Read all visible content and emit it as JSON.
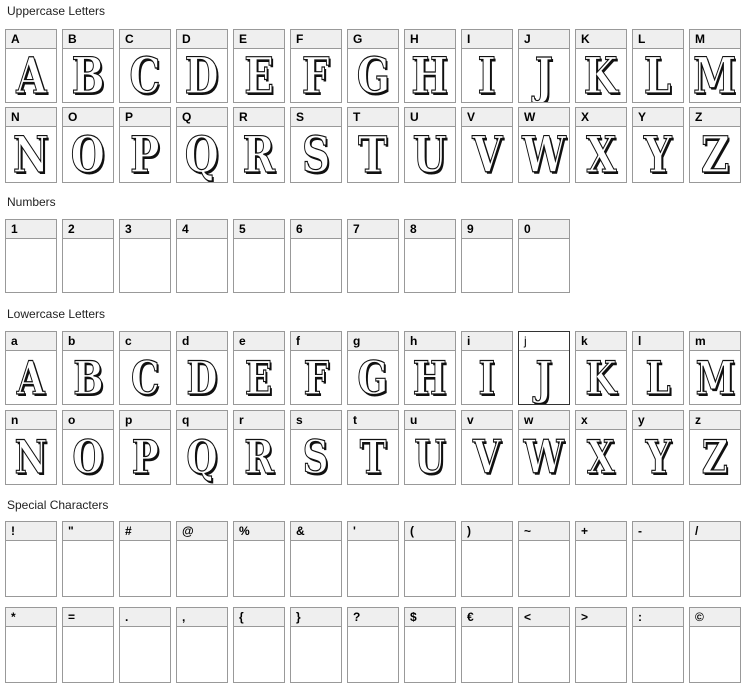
{
  "sections": {
    "uppercase": {
      "title": "Uppercase Letters",
      "cells": [
        {
          "label": "A",
          "glyph": "A"
        },
        {
          "label": "B",
          "glyph": "B"
        },
        {
          "label": "C",
          "glyph": "C"
        },
        {
          "label": "D",
          "glyph": "D"
        },
        {
          "label": "E",
          "glyph": "E"
        },
        {
          "label": "F",
          "glyph": "F"
        },
        {
          "label": "G",
          "glyph": "G"
        },
        {
          "label": "H",
          "glyph": "H"
        },
        {
          "label": "I",
          "glyph": "I"
        },
        {
          "label": "J",
          "glyph": "J"
        },
        {
          "label": "K",
          "glyph": "K"
        },
        {
          "label": "L",
          "glyph": "L"
        },
        {
          "label": "M",
          "glyph": "M"
        },
        {
          "label": "N",
          "glyph": "N"
        },
        {
          "label": "O",
          "glyph": "O"
        },
        {
          "label": "P",
          "glyph": "P"
        },
        {
          "label": "Q",
          "glyph": "Q"
        },
        {
          "label": "R",
          "glyph": "R"
        },
        {
          "label": "S",
          "glyph": "S"
        },
        {
          "label": "T",
          "glyph": "T"
        },
        {
          "label": "U",
          "glyph": "U"
        },
        {
          "label": "V",
          "glyph": "V"
        },
        {
          "label": "W",
          "glyph": "W"
        },
        {
          "label": "X",
          "glyph": "X"
        },
        {
          "label": "Y",
          "glyph": "Y"
        },
        {
          "label": "Z",
          "glyph": "Z"
        }
      ]
    },
    "numbers": {
      "title": "Numbers",
      "cells": [
        {
          "label": "1",
          "glyph": ""
        },
        {
          "label": "2",
          "glyph": ""
        },
        {
          "label": "3",
          "glyph": ""
        },
        {
          "label": "4",
          "glyph": ""
        },
        {
          "label": "5",
          "glyph": ""
        },
        {
          "label": "6",
          "glyph": ""
        },
        {
          "label": "7",
          "glyph": ""
        },
        {
          "label": "8",
          "glyph": ""
        },
        {
          "label": "9",
          "glyph": ""
        },
        {
          "label": "0",
          "glyph": ""
        }
      ]
    },
    "lowercase": {
      "title": "Lowercase Letters",
      "cells": [
        {
          "label": "a",
          "glyph": "A"
        },
        {
          "label": "b",
          "glyph": "B"
        },
        {
          "label": "c",
          "glyph": "C"
        },
        {
          "label": "d",
          "glyph": "D"
        },
        {
          "label": "e",
          "glyph": "E"
        },
        {
          "label": "f",
          "glyph": "F"
        },
        {
          "label": "g",
          "glyph": "G"
        },
        {
          "label": "h",
          "glyph": "H"
        },
        {
          "label": "i",
          "glyph": "I"
        },
        {
          "label": "j",
          "glyph": "J"
        },
        {
          "label": "k",
          "glyph": "K"
        },
        {
          "label": "l",
          "glyph": "L"
        },
        {
          "label": "m",
          "glyph": "M"
        },
        {
          "label": "n",
          "glyph": "N"
        },
        {
          "label": "o",
          "glyph": "O"
        },
        {
          "label": "p",
          "glyph": "P"
        },
        {
          "label": "q",
          "glyph": "Q"
        },
        {
          "label": "r",
          "glyph": "R"
        },
        {
          "label": "s",
          "glyph": "S"
        },
        {
          "label": "t",
          "glyph": "T"
        },
        {
          "label": "u",
          "glyph": "U"
        },
        {
          "label": "v",
          "glyph": "V"
        },
        {
          "label": "w",
          "glyph": "W"
        },
        {
          "label": "x",
          "glyph": "X"
        },
        {
          "label": "y",
          "glyph": "Y"
        },
        {
          "label": "z",
          "glyph": "Z"
        }
      ]
    },
    "special": {
      "title": "Special Characters",
      "cells": [
        {
          "label": "!",
          "glyph": ""
        },
        {
          "label": "\"",
          "glyph": ""
        },
        {
          "label": "#",
          "glyph": ""
        },
        {
          "label": "@",
          "glyph": ""
        },
        {
          "label": "%",
          "glyph": ""
        },
        {
          "label": "&",
          "glyph": ""
        },
        {
          "label": "'",
          "glyph": ""
        },
        {
          "label": "(",
          "glyph": ""
        },
        {
          "label": ")",
          "glyph": ""
        },
        {
          "label": "~",
          "glyph": ""
        },
        {
          "label": "+",
          "glyph": ""
        },
        {
          "label": "-",
          "glyph": ""
        },
        {
          "label": "/",
          "glyph": ""
        },
        {
          "label": "*",
          "glyph": ""
        },
        {
          "label": "=",
          "glyph": ""
        },
        {
          "label": ".",
          "glyph": ""
        },
        {
          "label": ",",
          "glyph": ""
        },
        {
          "label": "{",
          "glyph": ""
        },
        {
          "label": "}",
          "glyph": ""
        },
        {
          "label": "?",
          "glyph": ""
        },
        {
          "label": "$",
          "glyph": ""
        },
        {
          "label": "€",
          "glyph": ""
        },
        {
          "label": "<",
          "glyph": ""
        },
        {
          "label": ">",
          "glyph": ""
        },
        {
          "label": ":",
          "glyph": ""
        },
        {
          "label": "©",
          "glyph": ""
        }
      ]
    }
  },
  "selected": {
    "section": "lowercase",
    "index": 9
  }
}
